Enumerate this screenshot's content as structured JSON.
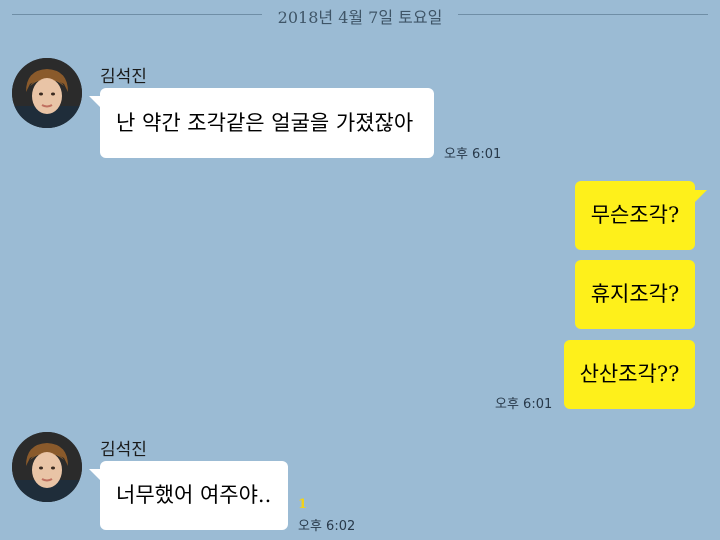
{
  "date_divider": "2018년 4월 7일 토요일",
  "messages": [
    {
      "sender": "김석진",
      "text": "난 약간 조각같은 얼굴을 가졌잖아",
      "time": "오후 6:01"
    },
    {
      "outgoing": [
        {
          "text": "무슨조각?"
        },
        {
          "text": "휴지조각?"
        },
        {
          "text": "산산조각??"
        }
      ],
      "time": "오후 6:01"
    },
    {
      "sender": "김석진",
      "text": "너무했어 여주야..",
      "unread_count": "1",
      "time": "오후 6:02"
    }
  ],
  "colors": {
    "background": "#9bbbd4",
    "outgoing_bubble": "#fef01b",
    "incoming_bubble": "#ffffff",
    "unread": "#f2d21a"
  },
  "icons": [
    "profile-avatar"
  ]
}
